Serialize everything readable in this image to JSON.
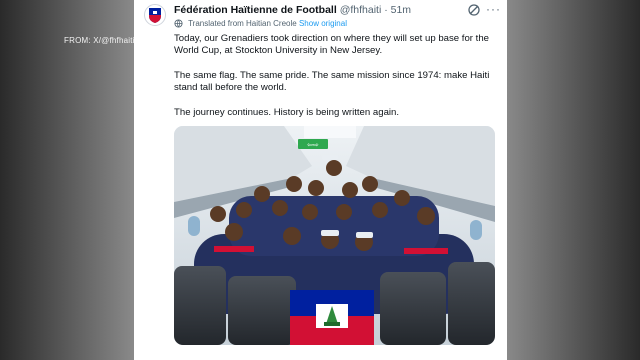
{
  "caption": "FROM: X/@fhfhaiti",
  "tweet": {
    "author_name": "Fédération Haïtienne de Football",
    "handle": "@fhfhaiti",
    "time": "· 51m",
    "translated_label": "Translated from Haitian Creole",
    "show_original": "Show original",
    "paragraphs": [
      "Today, our Grenadiers took direction on where they will set up base for the World Cup, at Stockton University in New Jersey.",
      "The same flag. The same pride. The same mission since 1974: make Haiti stand tall before the world.",
      "The journey continues. History is being written again."
    ],
    "photo_exit_sign": "⇦⇨"
  },
  "colors": {
    "link": "#1d9bf0",
    "haiti_blue": "#00209f",
    "haiti_red": "#d21034",
    "jersey": "#24305e"
  }
}
